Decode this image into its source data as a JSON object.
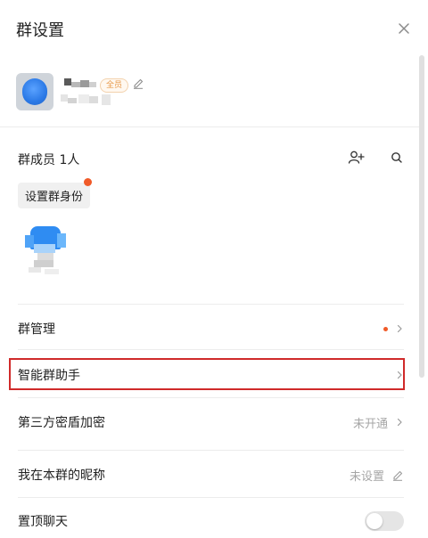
{
  "header": {
    "title": "群设置"
  },
  "group": {
    "member_badge": "全员"
  },
  "members": {
    "count_label": "群成员 1人",
    "set_identity_label": "设置群身份"
  },
  "settings": {
    "group_manage": {
      "label": "群管理"
    },
    "smart_assistant": {
      "label": "智能群助手"
    },
    "third_party_encryption": {
      "label": "第三方密盾加密",
      "value": "未开通"
    },
    "my_nickname": {
      "label": "我在本群的昵称",
      "value": "未设置"
    },
    "pin_chat": {
      "label": "置顶聊天",
      "enabled": false
    }
  },
  "colors": {
    "accent_red": "#f05a28",
    "highlight_border": "#d02a2a",
    "badge_text": "#e79a4b"
  },
  "icons": [
    "close-icon",
    "edit-icon",
    "add-member-icon",
    "search-icon",
    "chevron-right-icon"
  ]
}
